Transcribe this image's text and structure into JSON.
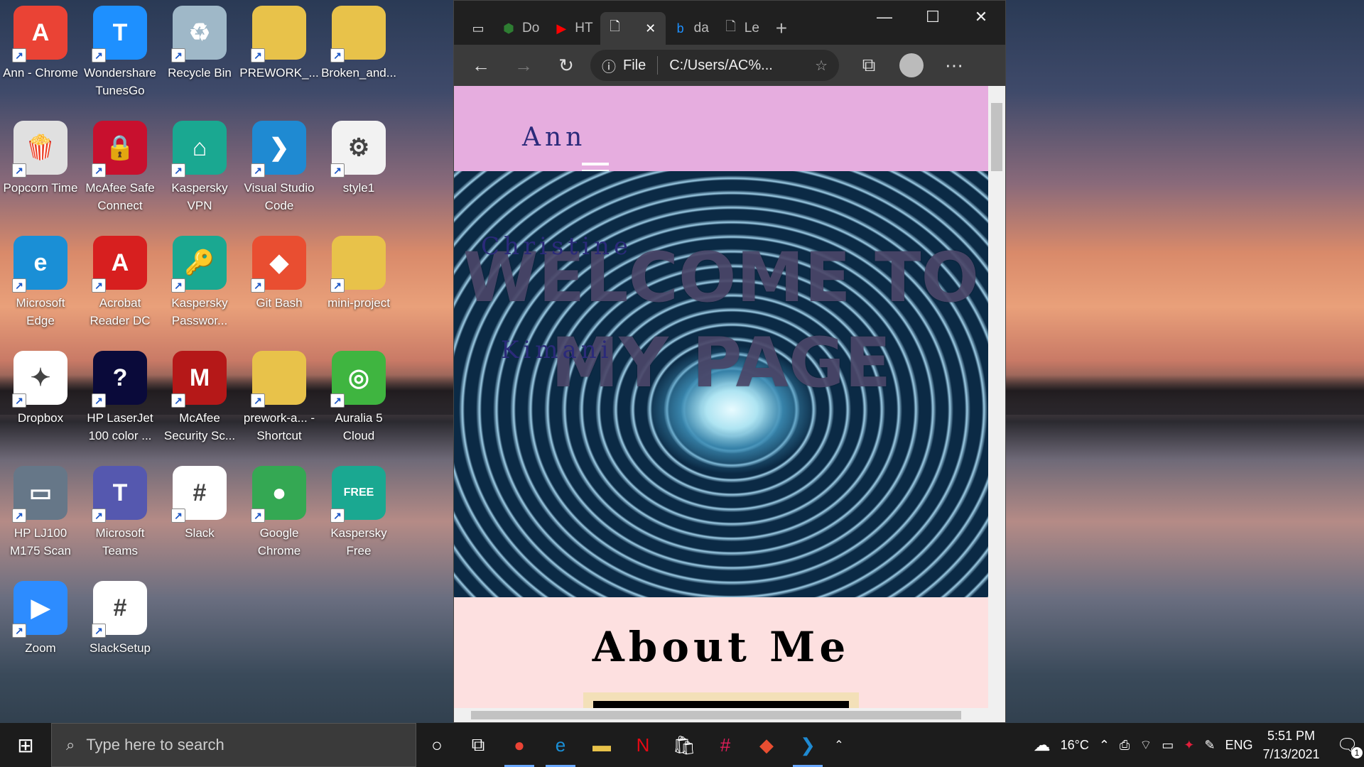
{
  "desktop": {
    "icons": [
      {
        "label": "Ann - Chrome",
        "icon": "chrome-icon",
        "color": "#ea4335",
        "glyph": "A"
      },
      {
        "label": "Wondershare TunesGo",
        "icon": "tunesgo-icon",
        "color": "#1e90ff",
        "glyph": "T"
      },
      {
        "label": "Recycle Bin",
        "icon": "recycle-bin-icon",
        "color": "#9fb8c8",
        "glyph": "♻"
      },
      {
        "label": "PREWORK_...",
        "icon": "folder-icon",
        "color": "#e8c24a",
        "glyph": ""
      },
      {
        "label": "Broken_and...",
        "icon": "zip-folder-icon",
        "color": "#e8c24a",
        "glyph": ""
      },
      {
        "label": "Popcorn Time",
        "icon": "popcorn-icon",
        "color": "#e0e0e0",
        "glyph": "🍿"
      },
      {
        "label": "McAfee Safe Connect",
        "icon": "mcafee-icon",
        "color": "#c8102e",
        "glyph": "🔒"
      },
      {
        "label": "Kaspersky VPN",
        "icon": "kaspersky-vpn-icon",
        "color": "#1aa891",
        "glyph": "⌂"
      },
      {
        "label": "Visual Studio Code",
        "icon": "vscode-icon",
        "color": "#1f8ad2",
        "glyph": "❯"
      },
      {
        "label": "style1",
        "icon": "css-file-icon",
        "color": "#f2f2f2",
        "glyph": "⚙"
      },
      {
        "label": "Microsoft Edge",
        "icon": "edge-icon",
        "color": "#1a8fd6",
        "glyph": "e"
      },
      {
        "label": "Acrobat Reader DC",
        "icon": "acrobat-icon",
        "color": "#d71f1f",
        "glyph": "A"
      },
      {
        "label": "Kaspersky Passwor...",
        "icon": "kaspersky-password-icon",
        "color": "#1aa891",
        "glyph": "🔑"
      },
      {
        "label": "Git Bash",
        "icon": "git-bash-icon",
        "color": "#e94e31",
        "glyph": "◆"
      },
      {
        "label": "mini-project",
        "icon": "folder-icon",
        "color": "#e8c24a",
        "glyph": ""
      },
      {
        "label": "Dropbox",
        "icon": "dropbox-icon",
        "color": "#ffffff",
        "glyph": "✦"
      },
      {
        "label": "HP LaserJet 100 color ...",
        "icon": "hp-icon",
        "color": "#0a0a3a",
        "glyph": "?"
      },
      {
        "label": "McAfee Security Sc...",
        "icon": "mcafee-scan-icon",
        "color": "#b51818",
        "glyph": "M"
      },
      {
        "label": "prework-a... - Shortcut",
        "icon": "folder-shortcut-icon",
        "color": "#e8c24a",
        "glyph": ""
      },
      {
        "label": "Auralia 5 Cloud",
        "icon": "auralia-icon",
        "color": "#3fb540",
        "glyph": "◎"
      },
      {
        "label": "HP LJ100 M175 Scan",
        "icon": "scanner-icon",
        "color": "#667788",
        "glyph": "▭"
      },
      {
        "label": "Microsoft Teams",
        "icon": "teams-icon",
        "color": "#5558af",
        "glyph": "T"
      },
      {
        "label": "Slack",
        "icon": "slack-icon",
        "color": "#ffffff",
        "glyph": "#"
      },
      {
        "label": "Google Chrome",
        "icon": "chrome-icon",
        "color": "#34a853",
        "glyph": "●"
      },
      {
        "label": "Kaspersky Free",
        "icon": "kaspersky-free-icon",
        "color": "#1aa891",
        "glyph": "FREE"
      },
      {
        "label": "Zoom",
        "icon": "zoom-icon",
        "color": "#2d8cff",
        "glyph": "▶"
      },
      {
        "label": "SlackSetup",
        "icon": "slack-icon",
        "color": "#ffffff",
        "glyph": "#"
      }
    ]
  },
  "browser": {
    "tabs": [
      {
        "label": "Do",
        "icon": "kaspersky-tab-icon"
      },
      {
        "label": "HT",
        "icon": "youtube-icon"
      },
      {
        "label": "",
        "icon": "file-icon",
        "active": true
      },
      {
        "label": "da",
        "icon": "bing-icon"
      },
      {
        "label": "Le",
        "icon": "file-icon"
      }
    ],
    "address": {
      "scheme": "File",
      "url": "C:/Users/AC%..."
    },
    "page": {
      "name": "Ann",
      "hero_title_line1": "WELCOME TO",
      "hero_title_line2": "MY PAGE",
      "hero_sub1": "Christine",
      "hero_sub2": "Kimani",
      "about_heading": "About Me"
    }
  },
  "taskbar": {
    "search_placeholder": "Type here to search",
    "weather": "16°C",
    "language": "ENG",
    "time": "5:51 PM",
    "date": "7/13/2021",
    "notification_count": "1"
  }
}
